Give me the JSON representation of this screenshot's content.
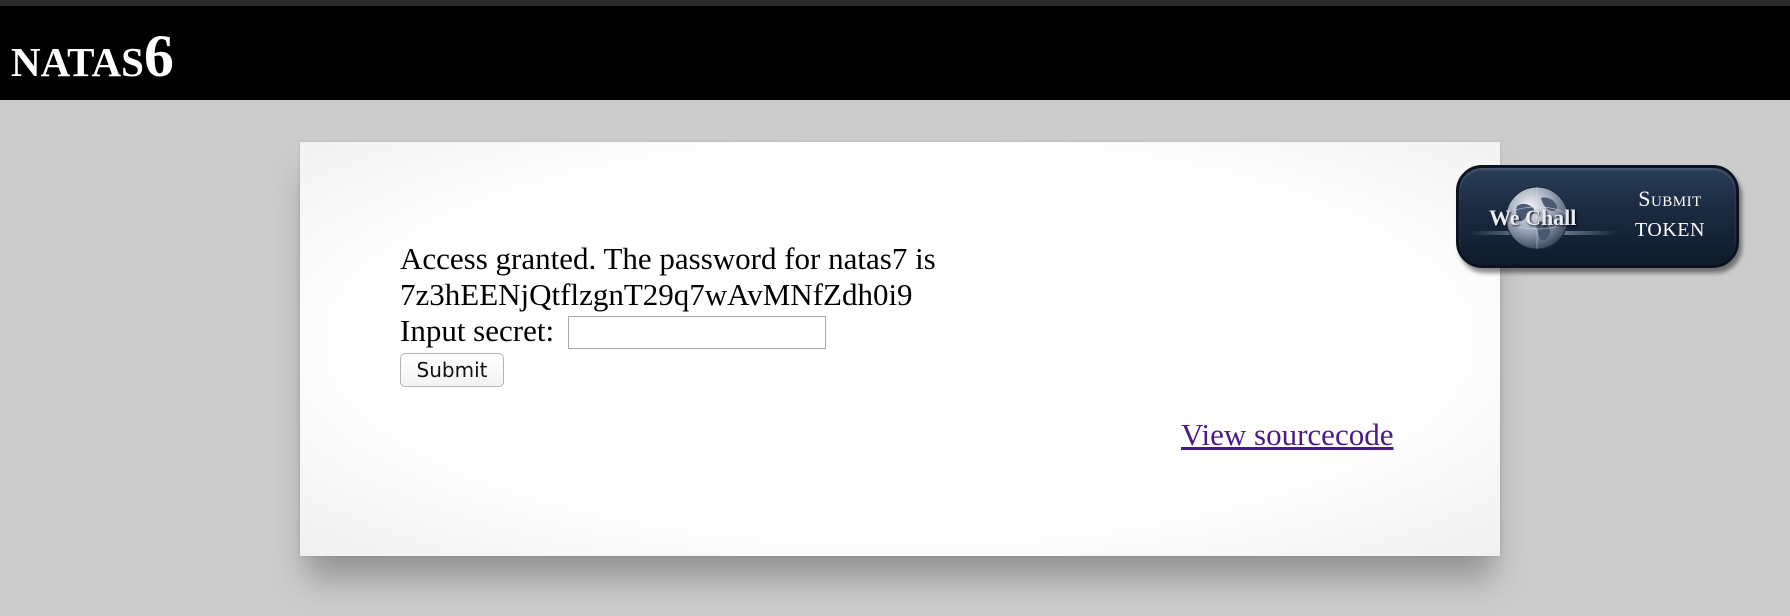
{
  "header": {
    "title_main": "NATAS",
    "title_num": "6"
  },
  "content": {
    "message_line1": "Access granted. The password for natas7 is",
    "message_line2": "7z3hEENjQtflzgnT29q7wAvMNfZdh0i9",
    "secret_label": "Input secret: ",
    "secret_value": "",
    "submit_label": "Submit",
    "source_link": "View sourcecode"
  },
  "wechall_badge": {
    "brand": "We Chall",
    "line1": "Submit",
    "line2": "TOKEN",
    "icon": "globe-icon"
  },
  "colors": {
    "background": "#cccccc",
    "header": "#000000",
    "link": "#4b1a87",
    "badge": "#1a2a40"
  }
}
